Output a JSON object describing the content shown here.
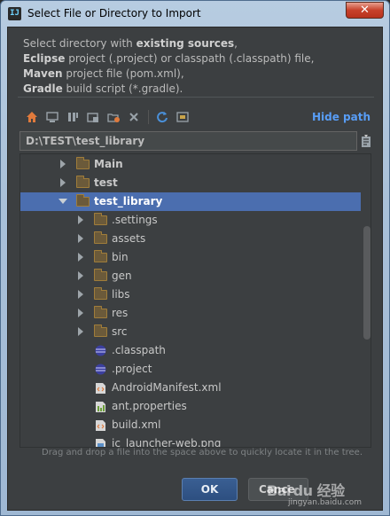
{
  "window": {
    "title": "Select File or Directory to Import",
    "app_icon_text": "IJ",
    "close_symbol": "✕"
  },
  "description": {
    "line1_pre": "Select directory with ",
    "line1_bold": "existing sources",
    "line1_post": ",",
    "line2_bold": "Eclipse",
    "line2_post": " project (.project) or classpath (.classpath) file,",
    "line3_bold": "Maven",
    "line3_post": " project file (pom.xml),",
    "line4_bold": "Gradle",
    "line4_post": " build script (*.gradle)."
  },
  "toolbar": {
    "icons": [
      "home-icon",
      "desktop-icon",
      "project-icon",
      "module-icon",
      "new-folder-icon",
      "delete-icon",
      "refresh-icon",
      "show-hidden-icon"
    ],
    "hide_path_label": "Hide path"
  },
  "path": {
    "value": "D:\\TEST\\test_library"
  },
  "tree": {
    "rows": [
      {
        "label": "Main",
        "type": "folder",
        "depth": 1,
        "expanded": false,
        "selected": false
      },
      {
        "label": "test",
        "type": "folder",
        "depth": 1,
        "expanded": false,
        "selected": false
      },
      {
        "label": "test_library",
        "type": "folder",
        "depth": 1,
        "expanded": true,
        "selected": true
      },
      {
        "label": ".settings",
        "type": "folder",
        "depth": 2,
        "expanded": false,
        "selected": false
      },
      {
        "label": "assets",
        "type": "folder",
        "depth": 2,
        "expanded": false,
        "selected": false
      },
      {
        "label": "bin",
        "type": "folder",
        "depth": 2,
        "expanded": false,
        "selected": false
      },
      {
        "label": "gen",
        "type": "folder",
        "depth": 2,
        "expanded": false,
        "selected": false
      },
      {
        "label": "libs",
        "type": "folder",
        "depth": 2,
        "expanded": false,
        "selected": false
      },
      {
        "label": "res",
        "type": "folder",
        "depth": 2,
        "expanded": false,
        "selected": false
      },
      {
        "label": "src",
        "type": "folder",
        "depth": 2,
        "expanded": false,
        "selected": false
      },
      {
        "label": ".classpath",
        "type": "eclipse-file",
        "depth": 2,
        "selected": false
      },
      {
        "label": ".project",
        "type": "eclipse-file",
        "depth": 2,
        "selected": false
      },
      {
        "label": "AndroidManifest.xml",
        "type": "xml-file",
        "depth": 2,
        "selected": false
      },
      {
        "label": "ant.properties",
        "type": "properties-file",
        "depth": 2,
        "selected": false
      },
      {
        "label": "build.xml",
        "type": "xml-file",
        "depth": 2,
        "selected": false
      },
      {
        "label": "ic_launcher-web.png",
        "type": "image-file",
        "depth": 2,
        "selected": false
      }
    ]
  },
  "hint": "Drag and drop a file into the space above to quickly locate it in the tree.",
  "buttons": {
    "ok": "OK",
    "cancel": "Cance"
  },
  "watermark": {
    "text": "Bai du 经验",
    "url": "jingyan.baidu.com"
  },
  "colors": {
    "background": "#3c3f41",
    "selection": "#4b6eaf",
    "link": "#589df6",
    "text": "#bbbbbb"
  }
}
